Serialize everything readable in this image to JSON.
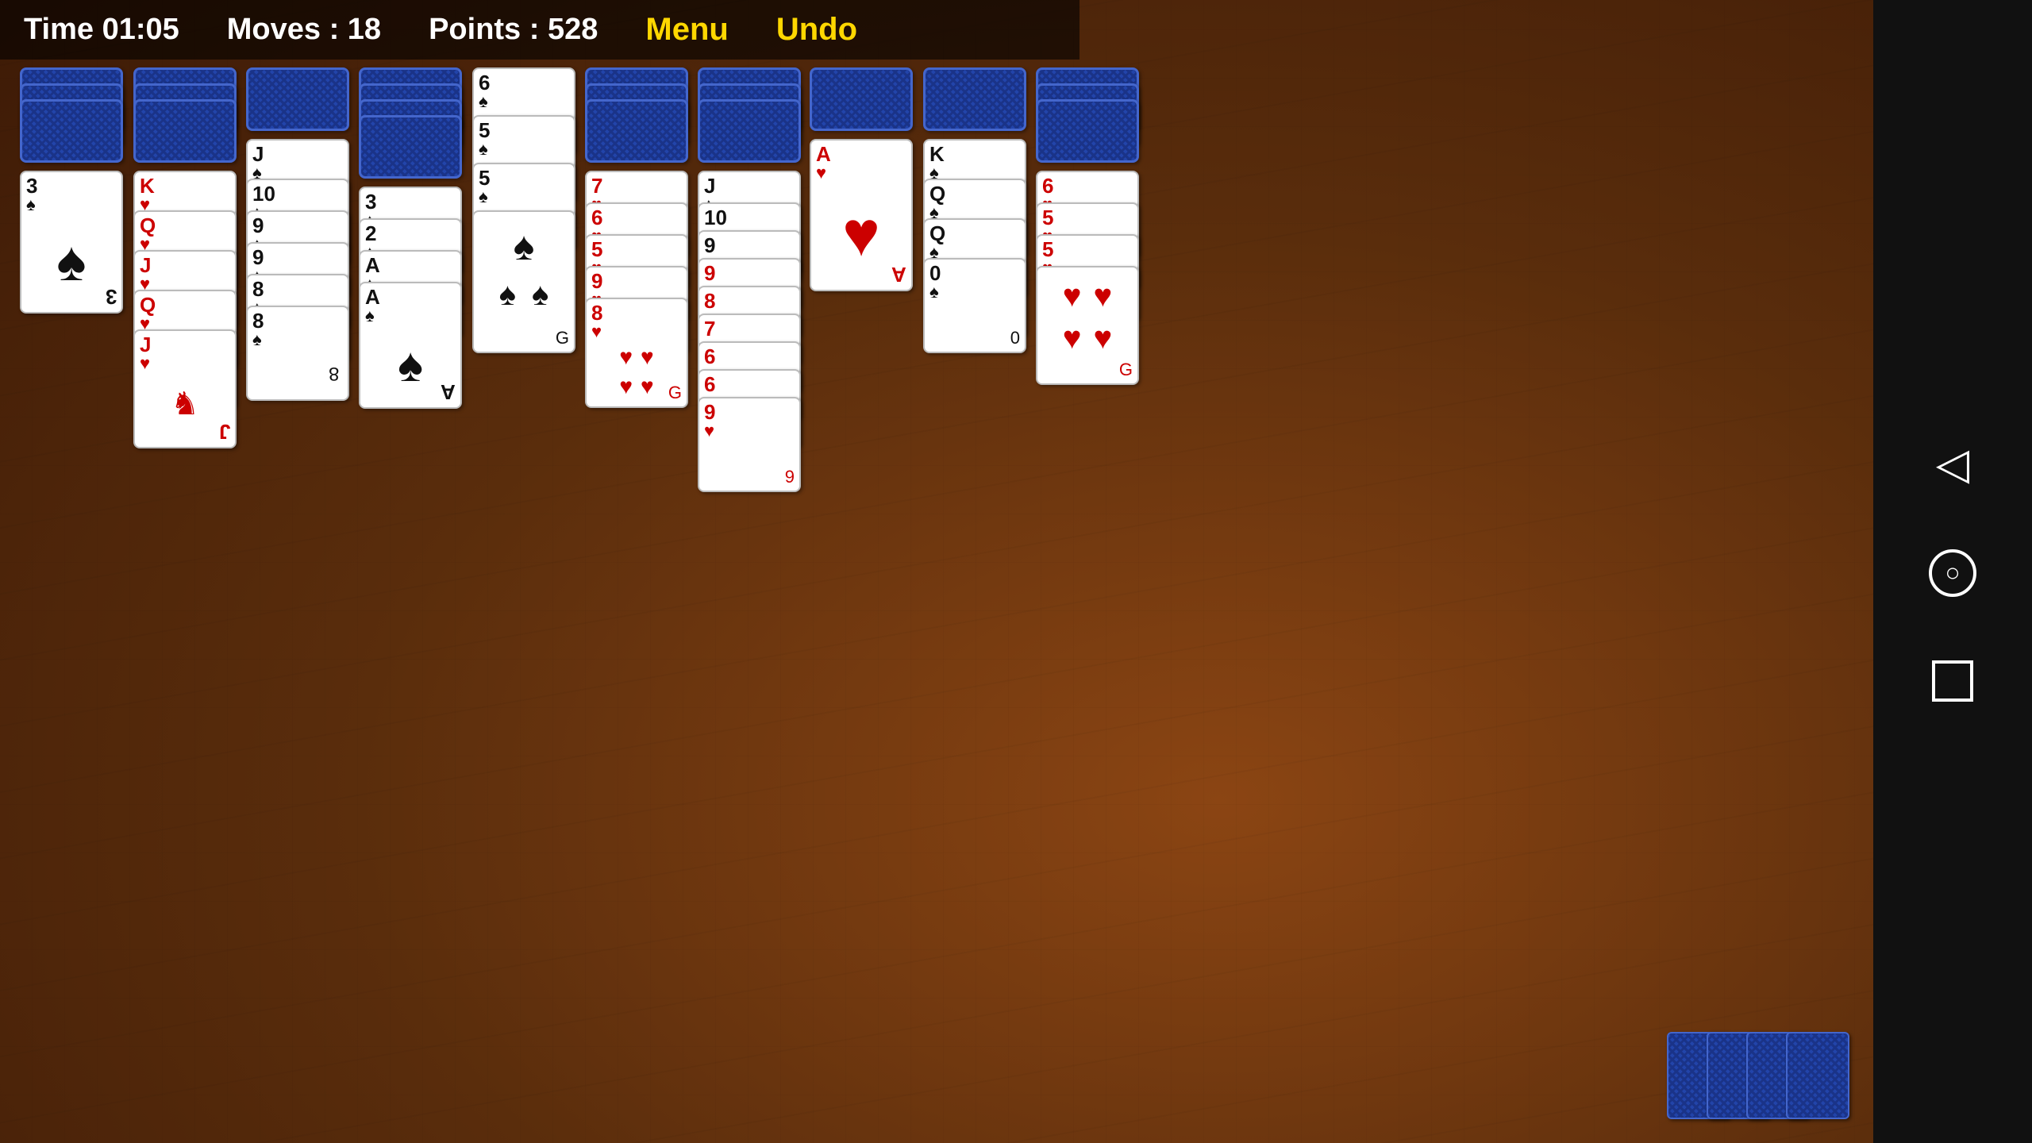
{
  "header": {
    "time_label": "Time 01:05",
    "moves_label": "Moves : 18",
    "points_label": "Points : 528",
    "menu_label": "Menu",
    "undo_label": "Undo"
  },
  "columns": [
    {
      "id": "col1",
      "backs": 3,
      "faces": [
        {
          "rank": "3",
          "suit": "♠",
          "color": "black",
          "tall": false
        }
      ]
    },
    {
      "id": "col2",
      "backs": 3,
      "faces": [
        {
          "rank": "K",
          "suit": "♥",
          "color": "red",
          "tall": true
        },
        {
          "rank": "Q",
          "suit": "♥",
          "color": "red",
          "tall": true
        },
        {
          "rank": "J",
          "suit": "♥",
          "color": "red",
          "tall": true
        },
        {
          "rank": "Q",
          "suit": "♥",
          "color": "red",
          "tall": true
        },
        {
          "rank": "J",
          "suit": "♥",
          "color": "red",
          "tall": true
        }
      ]
    },
    {
      "id": "col3",
      "backs": 1,
      "faces": [
        {
          "rank": "J",
          "suit": "♠",
          "color": "black",
          "tall": true
        },
        {
          "rank": "10",
          "suit": "♠",
          "color": "black",
          "tall": false
        },
        {
          "rank": "9",
          "suit": "♠",
          "color": "black",
          "tall": false
        },
        {
          "rank": "9",
          "suit": "♠",
          "color": "black",
          "tall": false
        },
        {
          "rank": "8",
          "suit": "♠",
          "color": "black",
          "tall": false
        },
        {
          "rank": "8",
          "suit": "♠",
          "color": "black",
          "tall": false
        }
      ]
    },
    {
      "id": "col4",
      "backs": 4,
      "faces": [
        {
          "rank": "3",
          "suit": "♠",
          "color": "black",
          "tall": false
        },
        {
          "rank": "2",
          "suit": "♠",
          "color": "black",
          "tall": false
        },
        {
          "rank": "A",
          "suit": "♠",
          "color": "black",
          "tall": false
        },
        {
          "rank": "A",
          "suit": "♠",
          "color": "black",
          "tall": false
        }
      ]
    },
    {
      "id": "col5",
      "backs": 0,
      "faces": [
        {
          "rank": "6",
          "suit": "♠",
          "color": "black",
          "tall": false
        },
        {
          "rank": "5",
          "suit": "♠",
          "color": "black",
          "tall": false
        },
        {
          "rank": "5",
          "suit": "♠",
          "color": "black",
          "tall": false
        },
        {
          "rank": "G",
          "suit": "♠",
          "color": "black",
          "tall": false
        }
      ]
    },
    {
      "id": "col6",
      "backs": 3,
      "faces": [
        {
          "rank": "7",
          "suit": "♥",
          "color": "red",
          "tall": false
        },
        {
          "rank": "6",
          "suit": "♥",
          "color": "red",
          "tall": false
        },
        {
          "rank": "5",
          "suit": "♥",
          "color": "red",
          "tall": false
        },
        {
          "rank": "9",
          "suit": "♥",
          "color": "red",
          "tall": false
        },
        {
          "rank": "8",
          "suit": "♥",
          "color": "red",
          "tall": false
        },
        {
          "rank": "G",
          "suit": "♥",
          "color": "red",
          "tall": false
        }
      ]
    },
    {
      "id": "col7",
      "backs": 3,
      "faces": [
        {
          "rank": "J",
          "suit": "♠",
          "color": "black",
          "tall": true
        },
        {
          "rank": "10",
          "suit": "♠",
          "color": "black",
          "tall": false
        },
        {
          "rank": "9",
          "suit": "♠",
          "color": "black",
          "tall": false
        },
        {
          "rank": "9",
          "suit": "♥",
          "color": "red",
          "tall": false
        },
        {
          "rank": "8",
          "suit": "♥",
          "color": "red",
          "tall": false
        },
        {
          "rank": "7",
          "suit": "♥",
          "color": "red",
          "tall": false
        },
        {
          "rank": "6",
          "suit": "♥",
          "color": "red",
          "tall": false
        },
        {
          "rank": "6",
          "suit": "♥",
          "color": "red",
          "tall": false
        },
        {
          "rank": "9",
          "suit": "♥",
          "color": "red",
          "tall": false
        }
      ]
    },
    {
      "id": "col8",
      "backs": 1,
      "faces": [
        {
          "rank": "A",
          "suit": "♥",
          "color": "red",
          "tall": false
        }
      ]
    },
    {
      "id": "col9",
      "backs": 1,
      "faces": [
        {
          "rank": "K",
          "suit": "♠",
          "color": "black",
          "tall": true
        },
        {
          "rank": "Q",
          "suit": "♠",
          "color": "black",
          "tall": true
        },
        {
          "rank": "Q",
          "suit": "♠",
          "color": "black",
          "tall": true
        },
        {
          "rank": "0",
          "suit": "♠",
          "color": "black",
          "tall": false
        }
      ]
    },
    {
      "id": "col10",
      "backs": 3,
      "faces": [
        {
          "rank": "6",
          "suit": "♥",
          "color": "red",
          "tall": false
        },
        {
          "rank": "5",
          "suit": "♥",
          "color": "red",
          "tall": false
        },
        {
          "rank": "5",
          "suit": "♥",
          "color": "red",
          "tall": false
        },
        {
          "rank": "G",
          "suit": "♥",
          "color": "red",
          "tall": false
        }
      ]
    }
  ],
  "nav": {
    "back_icon": "◁",
    "home_icon": "○",
    "square_icon": "□"
  }
}
